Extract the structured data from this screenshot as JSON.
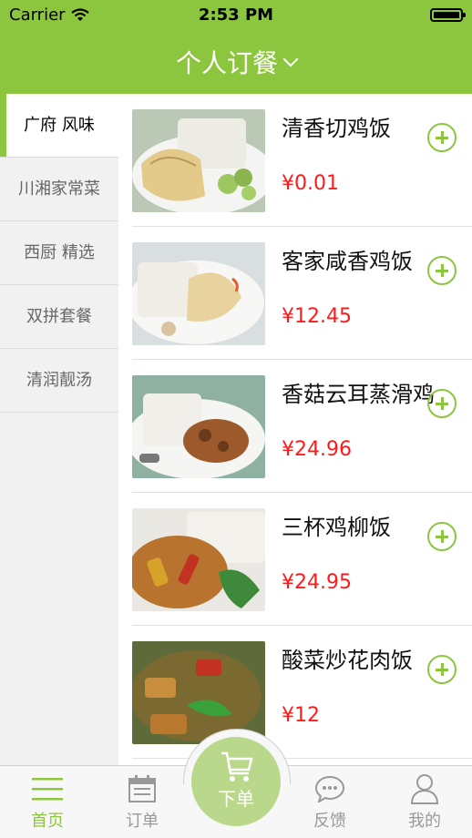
{
  "status_bar": {
    "carrier": "Carrier",
    "time": "2:53 PM"
  },
  "nav": {
    "title": "个人订餐"
  },
  "categories": [
    {
      "label": "广府 风味",
      "active": true
    },
    {
      "label": "川湘家常菜",
      "active": false
    },
    {
      "label": "西厨 精选",
      "active": false
    },
    {
      "label": "双拼套餐",
      "active": false
    },
    {
      "label": "清润靓汤",
      "active": false
    }
  ],
  "dishes": [
    {
      "name": "清香切鸡饭",
      "price": "¥0.01"
    },
    {
      "name": "客家咸香鸡饭",
      "price": "¥12.45"
    },
    {
      "name": "香菇云耳蒸滑鸡",
      "price": "¥24.96"
    },
    {
      "name": "三杯鸡柳饭",
      "price": "¥24.95"
    },
    {
      "name": "酸菜炒花肉饭",
      "price": "¥12"
    }
  ],
  "tabs": [
    {
      "label": "首页",
      "icon": "home-icon",
      "active": true
    },
    {
      "label": "订单",
      "icon": "calendar-icon",
      "active": false
    },
    {
      "label": "下单",
      "icon": "cart-icon",
      "active": false
    },
    {
      "label": "反馈",
      "icon": "chat-icon",
      "active": false
    },
    {
      "label": "我的",
      "icon": "user-icon",
      "active": false
    }
  ],
  "colors": {
    "accent": "#8cc63e",
    "price": "#ff1a1a",
    "sidebar_bg": "#f1f1f1"
  }
}
